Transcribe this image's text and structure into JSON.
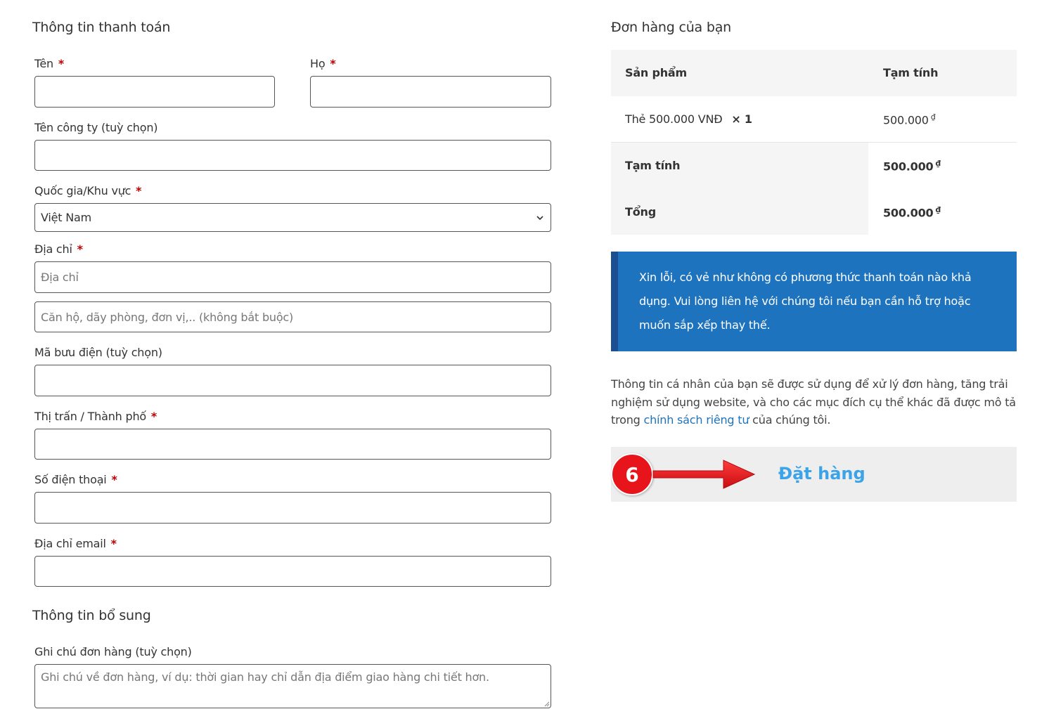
{
  "billing": {
    "title": "Thông tin thanh toán",
    "first_name": {
      "label": "Tên",
      "required": "*",
      "value": ""
    },
    "last_name": {
      "label": "Họ",
      "required": "*",
      "value": ""
    },
    "company": {
      "label": "Tên công ty (tuỳ chọn)",
      "value": ""
    },
    "country": {
      "label": "Quốc gia/Khu vực",
      "required": "*",
      "selected": "Việt Nam"
    },
    "address": {
      "label": "Địa chỉ",
      "required": "*",
      "placeholder_1": "Địa chỉ",
      "placeholder_2": "Căn hộ, dãy phòng, đơn vị,.. (không bắt buộc)"
    },
    "postcode": {
      "label": "Mã bưu điện (tuỳ chọn)",
      "value": ""
    },
    "city": {
      "label": "Thị trấn / Thành phố",
      "required": "*",
      "value": ""
    },
    "phone": {
      "label": "Số điện thoại",
      "required": "*",
      "value": ""
    },
    "email": {
      "label": "Địa chỉ email",
      "required": "*",
      "value": ""
    }
  },
  "additional": {
    "title": "Thông tin bổ sung",
    "notes": {
      "label": "Ghi chú đơn hàng (tuỳ chọn)",
      "placeholder": "Ghi chú về đơn hàng, ví dụ: thời gian hay chỉ dẫn địa điểm giao hàng chi tiết hơn."
    }
  },
  "order": {
    "title": "Đơn hàng của bạn",
    "col_product": "Sản phẩm",
    "col_subtotal": "Tạm tính",
    "item_name": "Thẻ 500.000 VNĐ",
    "item_qty": "× 1",
    "item_price": "500.000",
    "subtotal_label": "Tạm tính",
    "subtotal_value": "500.000",
    "total_label": "Tổng",
    "total_value": "500.000",
    "currency": "₫"
  },
  "notice": {
    "text": "Xin lỗi, có vẻ như không có phương thức thanh toán nào khả dụng. Vui lòng liên hệ với chúng tôi nếu bạn cần hỗ trợ hoặc muốn sắp xếp thay thế."
  },
  "privacy": {
    "before": "Thông tin cá nhân của bạn sẽ được sử dụng để xử lý đơn hàng, tăng trải nghiệm sử dụng website, và cho các mục đích cụ thể khác đã được mô tả trong ",
    "link": "chính sách riêng tư",
    "after": " của chúng tôi."
  },
  "place_order": {
    "label": "Đặt hàng",
    "step_number": "6"
  },
  "colors": {
    "notice_bg": "#1e73be",
    "notice_border": "#1b4f8f",
    "link": "#1e73be",
    "place_order_text": "#3ba3e8",
    "step_badge": "#e8141c",
    "required": "#c00000"
  },
  "icons": [
    "chevron-down-icon",
    "right-arrow-icon",
    "resize-grip-icon"
  ]
}
